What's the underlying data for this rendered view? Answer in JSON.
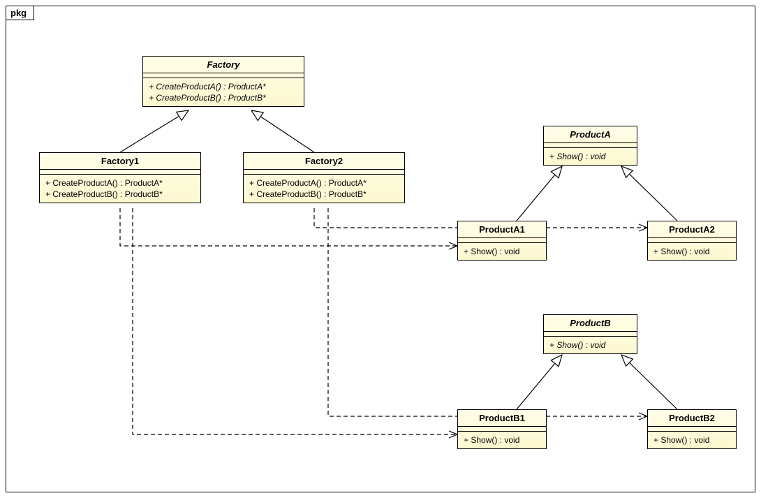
{
  "package": {
    "name": "pkg"
  },
  "classes": {
    "factory": {
      "name": "Factory",
      "ops": [
        "+ CreateProductA() : ProductA*",
        "+ CreateProductB() : ProductB*"
      ]
    },
    "factory1": {
      "name": "Factory1",
      "ops": [
        "+ CreateProductA() : ProductA*",
        "+ CreateProductB() : ProductB*"
      ]
    },
    "factory2": {
      "name": "Factory2",
      "ops": [
        "+ CreateProductA() : ProductA*",
        "+ CreateProductB() : ProductB*"
      ]
    },
    "productA": {
      "name": "ProductA",
      "ops": [
        "+ Show() : void"
      ]
    },
    "productA1": {
      "name": "ProductA1",
      "ops": [
        "+ Show() : void"
      ]
    },
    "productA2": {
      "name": "ProductA2",
      "ops": [
        "+ Show() : void"
      ]
    },
    "productB": {
      "name": "ProductB",
      "ops": [
        "+ Show() : void"
      ]
    },
    "productB1": {
      "name": "ProductB1",
      "ops": [
        "+ Show() : void"
      ]
    },
    "productB2": {
      "name": "ProductB2",
      "ops": [
        "+ Show() : void"
      ]
    }
  },
  "chart_data": {
    "type": "uml-class-diagram",
    "package": "pkg",
    "classes": [
      {
        "id": "Factory",
        "abstract": true,
        "operations": [
          "+ CreateProductA() : ProductA*",
          "+ CreateProductB() : ProductB*"
        ]
      },
      {
        "id": "Factory1",
        "abstract": false,
        "operations": [
          "+ CreateProductA() : ProductA*",
          "+ CreateProductB() : ProductB*"
        ]
      },
      {
        "id": "Factory2",
        "abstract": false,
        "operations": [
          "+ CreateProductA() : ProductA*",
          "+ CreateProductB() : ProductB*"
        ]
      },
      {
        "id": "ProductA",
        "abstract": true,
        "operations": [
          "+ Show() : void"
        ]
      },
      {
        "id": "ProductA1",
        "abstract": false,
        "operations": [
          "+ Show() : void"
        ]
      },
      {
        "id": "ProductA2",
        "abstract": false,
        "operations": [
          "+ Show() : void"
        ]
      },
      {
        "id": "ProductB",
        "abstract": true,
        "operations": [
          "+ Show() : void"
        ]
      },
      {
        "id": "ProductB1",
        "abstract": false,
        "operations": [
          "+ Show() : void"
        ]
      },
      {
        "id": "ProductB2",
        "abstract": false,
        "operations": [
          "+ Show() : void"
        ]
      }
    ],
    "relations": [
      {
        "type": "generalization",
        "from": "Factory1",
        "to": "Factory"
      },
      {
        "type": "generalization",
        "from": "Factory2",
        "to": "Factory"
      },
      {
        "type": "generalization",
        "from": "ProductA1",
        "to": "ProductA"
      },
      {
        "type": "generalization",
        "from": "ProductA2",
        "to": "ProductA"
      },
      {
        "type": "generalization",
        "from": "ProductB1",
        "to": "ProductB"
      },
      {
        "type": "generalization",
        "from": "ProductB2",
        "to": "ProductB"
      },
      {
        "type": "dependency",
        "from": "Factory1",
        "to": "ProductA1"
      },
      {
        "type": "dependency",
        "from": "Factory1",
        "to": "ProductB1"
      },
      {
        "type": "dependency",
        "from": "Factory2",
        "to": "ProductA2"
      },
      {
        "type": "dependency",
        "from": "Factory2",
        "to": "ProductB2"
      }
    ]
  }
}
